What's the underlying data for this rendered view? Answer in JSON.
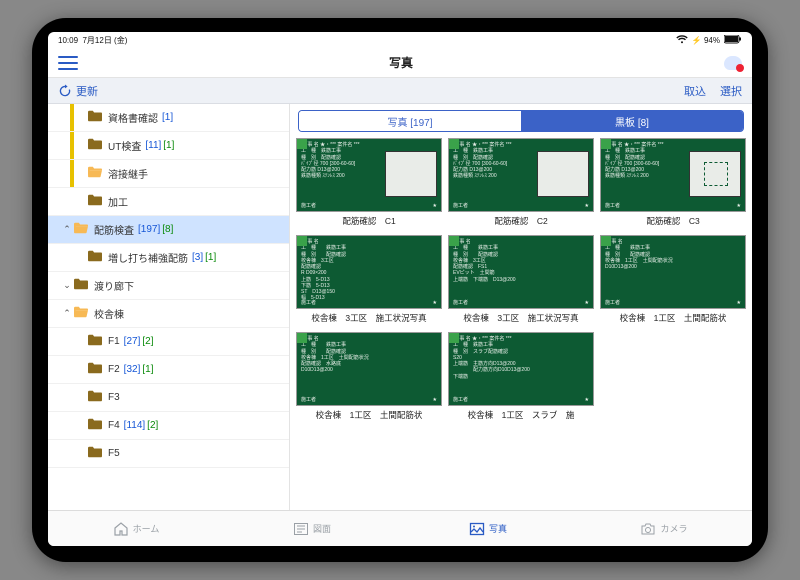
{
  "status": {
    "time": "10:09",
    "date": "7月12日 (金)",
    "battery": "94%"
  },
  "nav": {
    "title": "写真"
  },
  "toolbar": {
    "refresh": "更新",
    "import": "取込",
    "select": "選択"
  },
  "tree": [
    {
      "bar": "yellow",
      "indent": 1,
      "chev": "",
      "open": false,
      "label": "資格書確認",
      "c1": "[1]",
      "c2": ""
    },
    {
      "bar": "yellow",
      "indent": 1,
      "chev": "",
      "open": false,
      "label": "UT検査",
      "c1": "[11]",
      "c2": "[1]"
    },
    {
      "bar": "yellow",
      "indent": 1,
      "chev": "",
      "open": true,
      "label": "溶接継手",
      "c1": "",
      "c2": ""
    },
    {
      "bar": "none",
      "indent": 1,
      "chev": "",
      "open": false,
      "label": "加工",
      "c1": "",
      "c2": ""
    },
    {
      "bar": "none",
      "indent": 0,
      "chev": "⌃",
      "open": true,
      "label": "配筋検査",
      "c1": "[197]",
      "c2": "[8]",
      "selected": true
    },
    {
      "bar": "none",
      "indent": 1,
      "chev": "",
      "open": false,
      "label": "増し打ち補強配筋",
      "c1": "[3]",
      "c2": "[1]"
    },
    {
      "bar": "none",
      "indent": 0,
      "chev": "⌄",
      "open": false,
      "label": "渡り廊下",
      "c1": "",
      "c2": ""
    },
    {
      "bar": "none",
      "indent": 0,
      "chev": "⌃",
      "open": true,
      "label": "校舎棟",
      "c1": "",
      "c2": ""
    },
    {
      "bar": "none",
      "indent": 1,
      "chev": "",
      "open": false,
      "label": "F1",
      "c1": "[27]",
      "c2": "[2]"
    },
    {
      "bar": "none",
      "indent": 1,
      "chev": "",
      "open": false,
      "label": "F2",
      "c1": "[32]",
      "c2": "[1]"
    },
    {
      "bar": "none",
      "indent": 1,
      "chev": "",
      "open": false,
      "label": "F3",
      "c1": "",
      "c2": ""
    },
    {
      "bar": "none",
      "indent": 1,
      "chev": "",
      "open": false,
      "label": "F4",
      "c1": "[114]",
      "c2": "[2]"
    },
    {
      "bar": "none",
      "indent": 1,
      "chev": "",
      "open": false,
      "label": "F5",
      "c1": "",
      "c2": ""
    }
  ],
  "segment": {
    "left": "写真 [197]",
    "right": "黒板 [8]"
  },
  "cards": [
    {
      "diagram": "plain",
      "lines": [
        "工 事 名  ★・*** 案件名 ***",
        "工　種　鉄筋工事",
        "種　別　配筋確認",
        "",
        "ﾊﾟｲﾌﾟ径  700 [300-60-60]",
        "配力筋 D13@200",
        "鉄筋種類 ｽﾃﾝﾚｽ 200"
      ],
      "cap": "配筋確認　C1"
    },
    {
      "diagram": "plain",
      "lines": [
        "工 事 名  ★・*** 案件名 ***",
        "工　種　鉄筋工事",
        "種　別　配筋確認",
        "",
        "ﾊﾟｲﾌﾟ径  700 [300-60-60]",
        "配力筋 D13@200",
        "鉄筋種類 ｽﾃﾝﾚｽ 200"
      ],
      "cap": "配筋確認　C2"
    },
    {
      "diagram": "sq",
      "lines": [
        "工 事 名  ★・*** 案件名 ***",
        "工　種　鉄筋工事",
        "種　別　配筋確認",
        "",
        "ﾊﾟｲﾌﾟ径  700 [300-60-60]",
        "配力筋 D13@200",
        "鉄筋種類 ｽﾃﾝﾚｽ 200"
      ],
      "cap": "配筋確認　C3"
    },
    {
      "diagram": "",
      "lines": [
        "工 事 名",
        "工　種　　鉄筋工事",
        "種　別　　配筋確認",
        "校舎棟　3工区",
        "配筋確認",
        "R D09×200",
        "上筋　5-D13",
        "下筋　5-D13",
        "ST　D13@150",
        "幅　5-D13"
      ],
      "cap": "校舎棟　3工区　施工状況写真"
    },
    {
      "diagram": "",
      "lines": [
        "工 事 名",
        "工　種　　鉄筋工事",
        "種　別　　配筋確認",
        "校舎棟　3工区",
        "配筋確認　FS1",
        "EVピット　土間筋",
        "",
        "上端筋　下端筋　D13@200"
      ],
      "cap": "校舎棟　3工区　施工状況写真"
    },
    {
      "diagram": "",
      "lines": [
        "工 事 名",
        "工　種　　鉄筋工事",
        "種　別　　配筋確認",
        "校舎棟　1工区　土間配筋状況",
        "",
        "D10D13@200"
      ],
      "cap": "校舎棟　1工区　土間配筋状"
    },
    {
      "diagram": "",
      "lines": [
        "工 事 名",
        "工　種　　鉄筋工事",
        "種　別　　配筋確認",
        "校舎棟　1工区　土間配筋状況",
        "配筋確認　水路底",
        "",
        "D10D13@200"
      ],
      "cap": "校舎棟　1工区　土間配筋状"
    },
    {
      "diagram": "",
      "lines": [
        "工 事 名  ★・*** 案件名 ***",
        "工　種　鉄筋工事",
        "種　別　スラブ配筋確認",
        "S20",
        "",
        "上端筋　主筋方向D13@200",
        "　　　　配力筋方向D10D13@200",
        "下端筋"
      ],
      "cap": "校舎棟　1工区　スラブ　施"
    }
  ],
  "tabs": {
    "home": "ホーム",
    "draw": "図面",
    "photo": "写真",
    "camera": "カメラ"
  },
  "board_footer": {
    "left": "施工者",
    "right": "★"
  }
}
